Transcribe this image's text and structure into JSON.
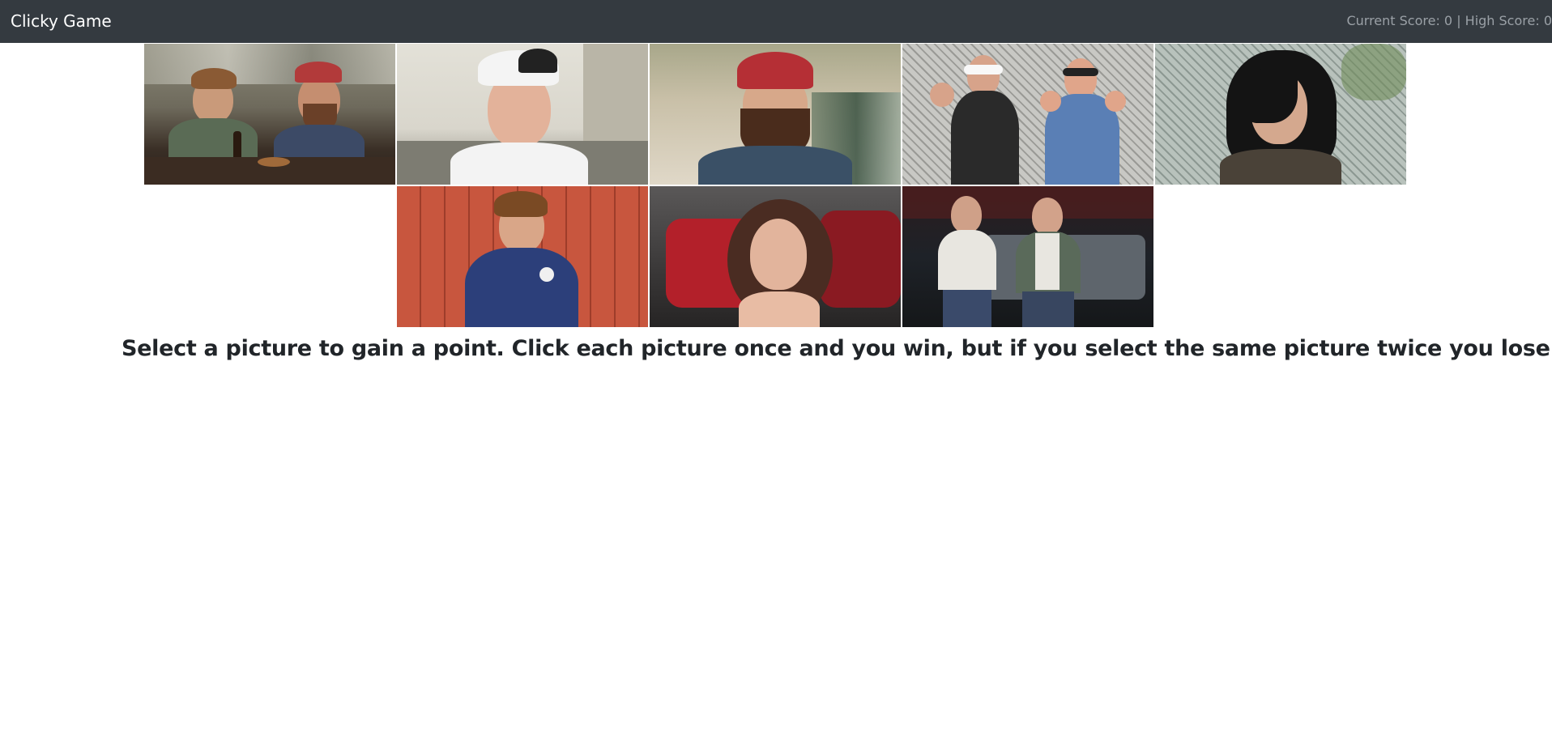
{
  "navbar": {
    "brand": "Clicky Game",
    "scores": "Current Score: 0 | High Score: 0"
  },
  "pictures": [
    {
      "row": 1,
      "icon": "photo-bar-table-two-men",
      "colors": {
        "bg": "#6e6a5c",
        "shirt": "#5a6b55",
        "overalls": "#3c4a66",
        "cap": "#b23a3a"
      }
    },
    {
      "row": 1,
      "icon": "photo-man-white-cap",
      "colors": {
        "bg": "#d9d6cc",
        "shirt": "#f3f3f3",
        "cap": "#222222"
      }
    },
    {
      "row": 1,
      "icon": "photo-bearded-man-red-cap",
      "colors": {
        "bg": "#c9c0a8",
        "shirt": "#3a5066",
        "cap": "#b52f35"
      }
    },
    {
      "row": 1,
      "icon": "photo-two-men-boxing-fence",
      "colors": {
        "bg": "#bcbcb8",
        "shirt": "#2a2a2a",
        "shirt2": "#5a7fb5"
      }
    },
    {
      "row": 1,
      "icon": "photo-dark-hair-woman-fence",
      "colors": {
        "bg": "#a9b3ad",
        "hair": "#141414",
        "scarf": "#4a4238"
      }
    },
    {
      "row": 2,
      "icon": "photo-man-red-barn",
      "colors": {
        "bg": "#c8563e",
        "shirt": "#2c3f7a"
      }
    },
    {
      "row": 2,
      "icon": "photo-woman-lying-red-bag",
      "colors": {
        "bg": "#3a3838",
        "bag": "#b3202a",
        "hair": "#4a2c22"
      }
    },
    {
      "row": 2,
      "icon": "photo-two-men-night-truck",
      "colors": {
        "bg": "#1e2228",
        "shirt": "#e8e6e0",
        "truck": "#5e656c"
      }
    }
  ],
  "instructions": "Select a picture to gain a point. Click each picture once and you win, but if you select the same picture twice you lose!"
}
